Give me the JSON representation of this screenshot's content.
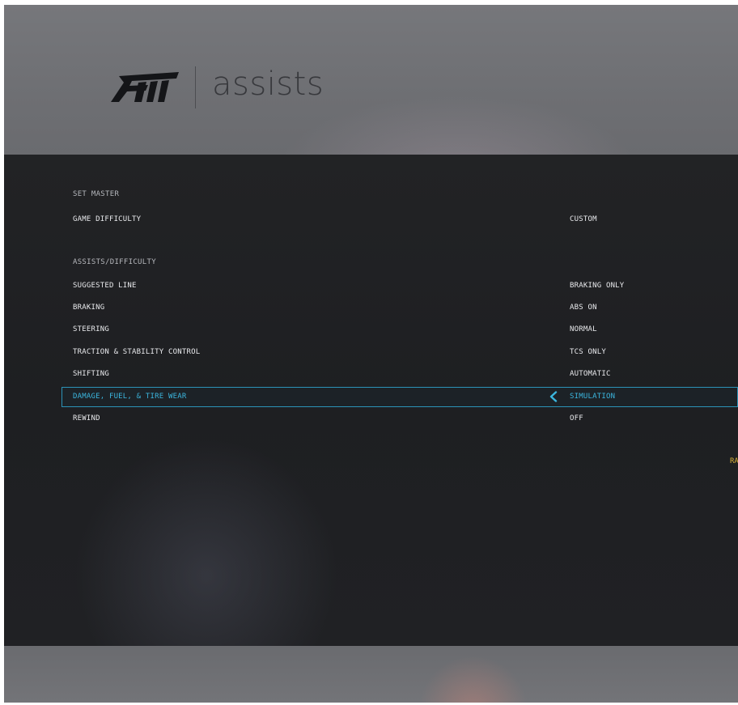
{
  "header": {
    "title": "assists",
    "logo_icon": "forza-motorsport-logo"
  },
  "set_master": {
    "section_label": "SET MASTER",
    "rows": [
      {
        "label": "GAME DIFFICULTY",
        "value": "CUSTOM"
      }
    ]
  },
  "assists": {
    "section_label": "ASSISTS/DIFFICULTY",
    "rows": [
      {
        "label": "SUGGESTED LINE",
        "value": "BRAKING ONLY",
        "selected": false
      },
      {
        "label": "BRAKING",
        "value": "ABS ON",
        "selected": false
      },
      {
        "label": "STEERING",
        "value": "NORMAL",
        "selected": false
      },
      {
        "label": "TRACTION & STABILITY CONTROL",
        "value": "TCS ONLY",
        "selected": false
      },
      {
        "label": "SHIFTING",
        "value": "AUTOMATIC",
        "selected": false
      },
      {
        "label": "DAMAGE, FUEL, & TIRE WEAR",
        "value": "SIMULATION",
        "selected": true
      },
      {
        "label": "REWIND",
        "value": "OFF",
        "selected": false
      }
    ]
  },
  "right_edge_text": "RA",
  "colors": {
    "accent": "#3bb6de",
    "highlight_border": "#2c93b8",
    "panel": "#1f2023",
    "warning_text": "#d9b23a"
  }
}
